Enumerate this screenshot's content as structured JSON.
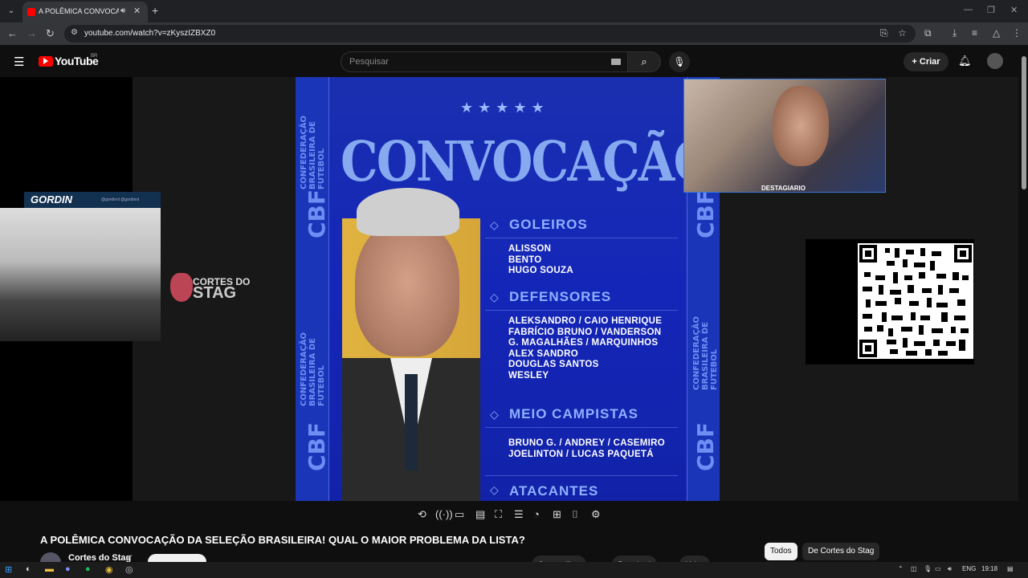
{
  "browser": {
    "tab_title": "A POLÊMICA CONVOCAÇÃ",
    "url": "youtube.com/watch?v=zKyszIZBXZ0"
  },
  "youtube": {
    "logo_text": "YouTube",
    "region": "BR",
    "search_placeholder": "Pesquisar",
    "create_label": "Criar"
  },
  "video": {
    "overlay_left": {
      "streamer": "GORDIN",
      "handles": "@gordinnl  @gordinnl",
      "brand_line1": "CORTES DO",
      "brand_line2": "STAG"
    },
    "overlay_right_label": "DESTAGIARIO",
    "poster": {
      "band_left": "CONFEDERAÇÃO BRASILEIRA DE FUTEBOL",
      "band_logo": "CBF",
      "title": "CONVOCAÇÃO",
      "sections": [
        {
          "heading": "GOLEIROS",
          "names": [
            "ALISSON",
            "BENTO",
            "HUGO SOUZA"
          ]
        },
        {
          "heading": "DEFENSORES",
          "names": [
            "ALEKSANDRO / CAIO HENRIQUE",
            "FABRÍCIO BRUNO / VANDERSON",
            "G. MAGALHÃES / MARQUINHOS",
            "ALEX SANDRO",
            "DOUGLAS SANTOS",
            "WESLEY"
          ]
        },
        {
          "heading": "MEIO CAMPISTAS",
          "names": [
            "BRUNO G. / ANDREY / CASEMIRO",
            "JOELINTON / LUCAS PAQUETÁ"
          ]
        },
        {
          "heading": "ATACANTES",
          "names": []
        }
      ]
    }
  },
  "info": {
    "title": "A POLÊMICA CONVOCAÇÃO DA SELEÇÃO BRASILEIRA! QUAL O MAIOR PROBLEMA DA LISTA?",
    "channel": "Cortes do Stag",
    "chips": [
      "Todos",
      "De Cortes do Stag"
    ],
    "actions": [
      "Compartilhar",
      "Download",
      "Valeu"
    ]
  },
  "taskbar": {
    "lang": "ENG",
    "time": "19:18"
  }
}
